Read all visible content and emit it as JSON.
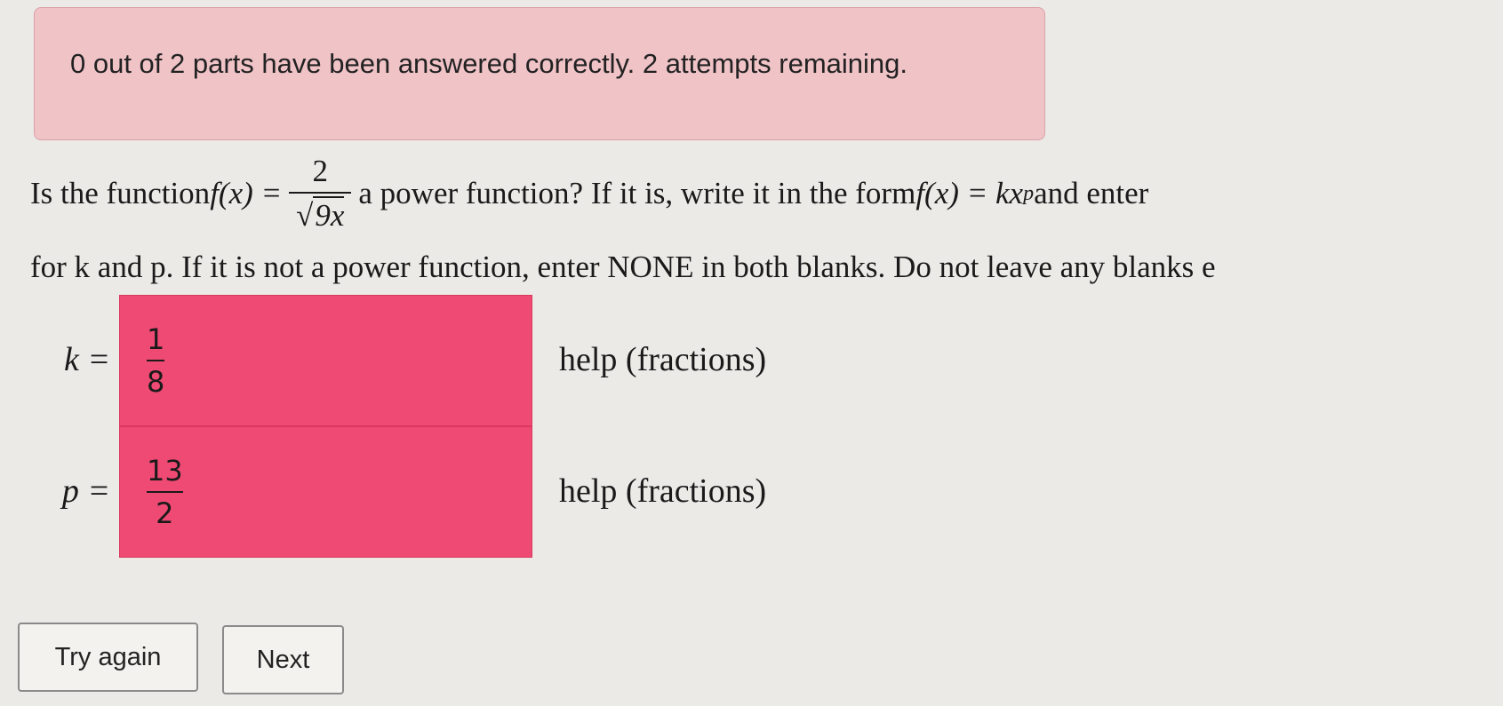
{
  "banner": {
    "message": "0 out of 2 parts have been answered correctly. 2 attempts remaining."
  },
  "question": {
    "prefix": "Is the function ",
    "func": "f(x) =",
    "numerator": "2",
    "denominator_root": "9x",
    "middle": " a power function? If it is, write it in the form ",
    "form": "f(x) = kx",
    "form_exp": "p",
    "suffix": " and enter",
    "line2": "for k and p. If it is not a power function, enter NONE in both blanks. Do not leave any blanks e"
  },
  "answers": [
    {
      "label": "k =",
      "numerator": "1",
      "denominator": "8",
      "help": "help (fractions)"
    },
    {
      "label": "p =",
      "numerator": "13",
      "denominator": "2",
      "help": "help (fractions)"
    }
  ],
  "buttons": {
    "try_again": "Try again",
    "next": "Next"
  },
  "colors": {
    "banner_bg": "#f0c3c7",
    "answer_incorrect": "#ef4a73"
  }
}
